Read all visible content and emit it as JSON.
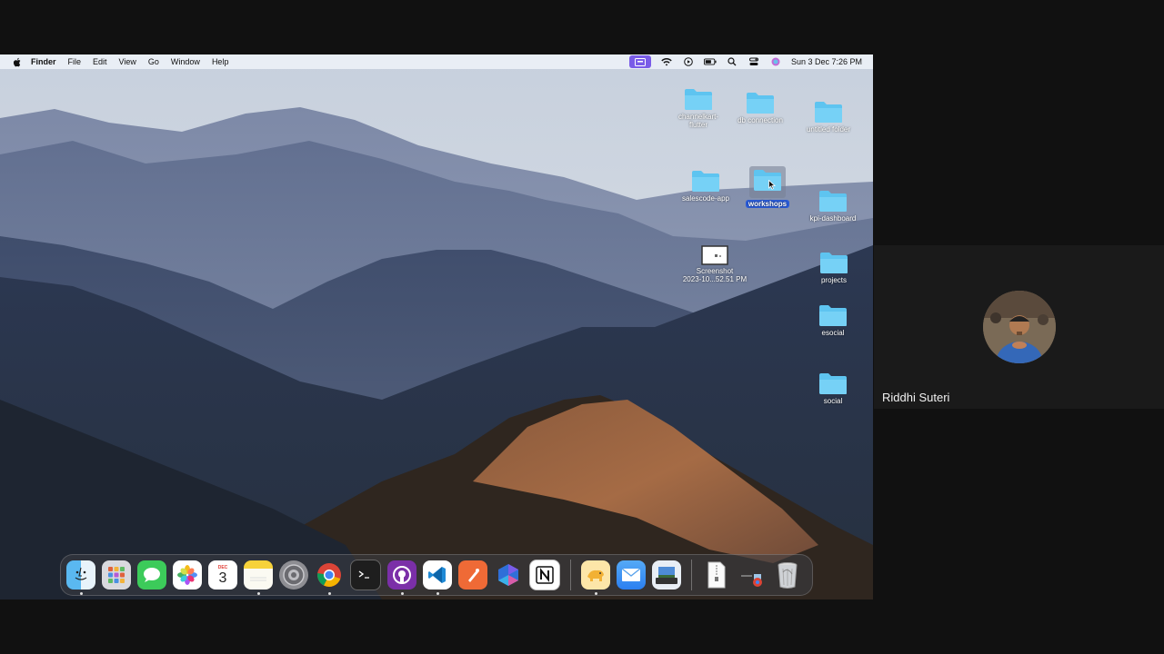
{
  "menubar": {
    "app_name": "Finder",
    "menus": [
      "File",
      "Edit",
      "View",
      "Go",
      "Window",
      "Help"
    ],
    "clock": "Sun 3 Dec  7:26 PM"
  },
  "desktop": {
    "icons": {
      "channelkart": "channelkart-\nflutter",
      "db_connection": "db connection",
      "untitled_folder": "untitled folder",
      "salescode_app": "salescode-app",
      "workshops": "workshops",
      "kpi_dashboard": "kpi-dashboard",
      "screenshot": "Screenshot\n2023-10...52.51 PM",
      "projects": "projects",
      "esocial": "esocial",
      "social": "social"
    }
  },
  "dock": {
    "apps": [
      "finder-icon",
      "launchpad-icon",
      "messages-icon",
      "photos-icon",
      "calendar-icon",
      "notes-icon",
      "system-settings-icon",
      "chrome-icon",
      "terminal-icon",
      "github-desktop-icon",
      "vscode-icon",
      "postman-icon",
      "copilot-icon",
      "notion-icon",
      "tableplus-icon",
      "mail-icon",
      "preview-icon",
      "document-icon",
      "downloads-stack-icon",
      "trash-icon"
    ],
    "calendar_month": "DEC",
    "calendar_day": "3"
  },
  "call": {
    "participant_name": "Riddhi Suteri"
  },
  "colors": {
    "folder": "#5ec4f0",
    "selection": "#2a5bd7",
    "menubar_active": "#7a5ce8"
  }
}
